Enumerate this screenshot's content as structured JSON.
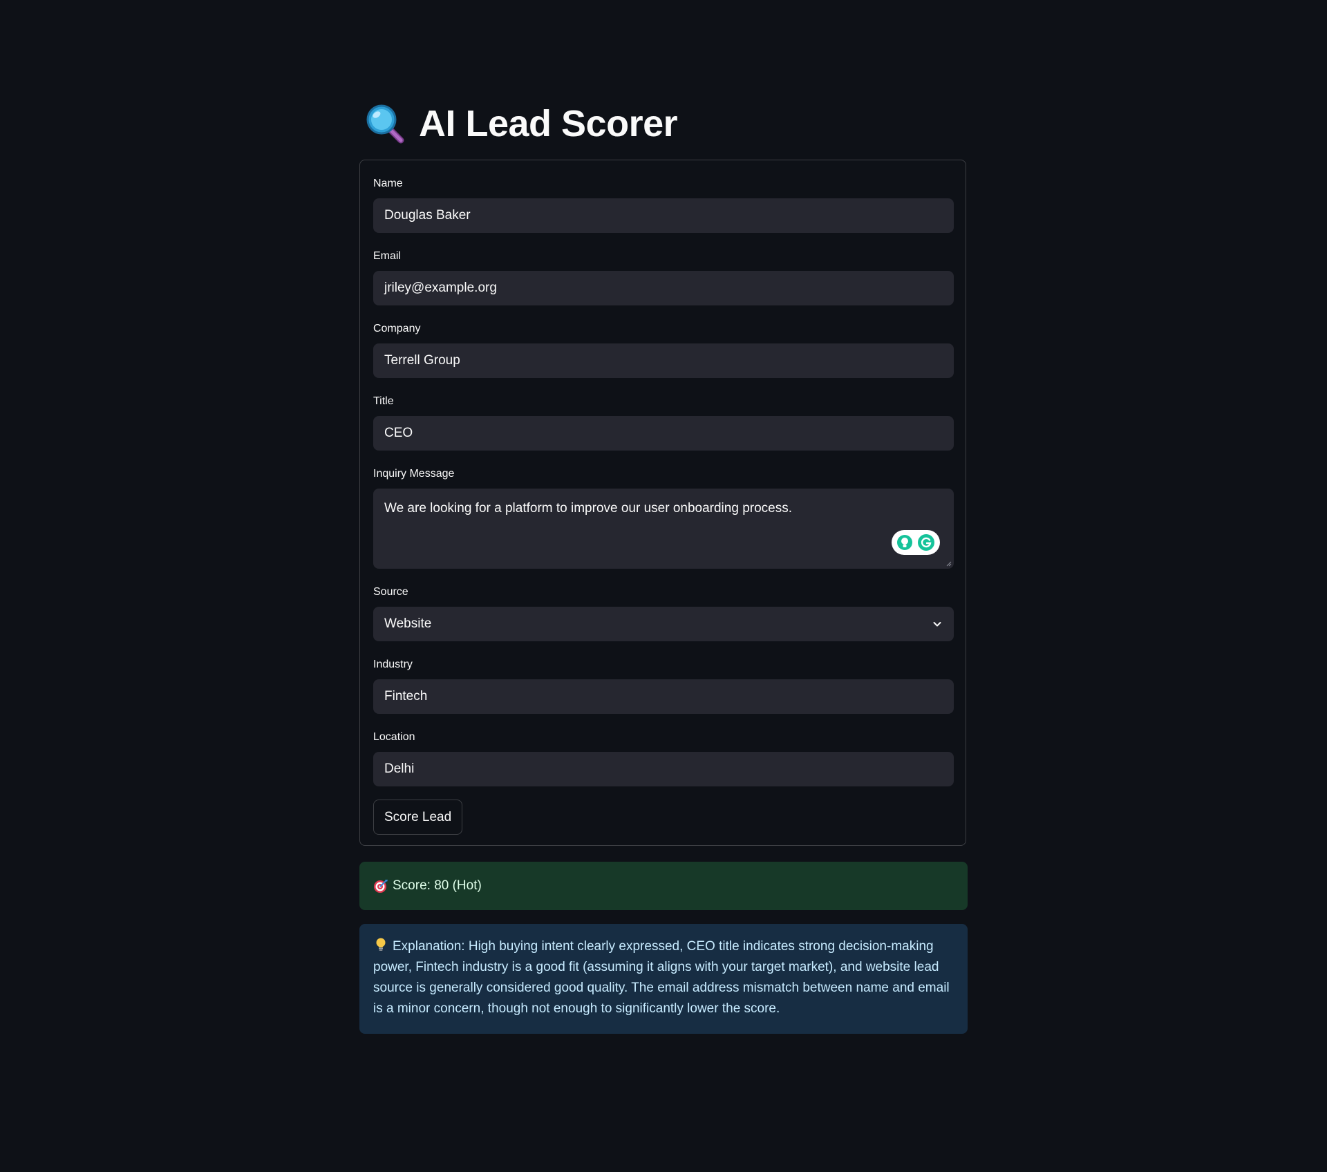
{
  "app": {
    "title": "AI Lead Scorer",
    "title_icon": "magnifying-glass-icon"
  },
  "form": {
    "fields": {
      "name": {
        "label": "Name",
        "value": "Douglas Baker"
      },
      "email": {
        "label": "Email",
        "value": "jriley@example.org"
      },
      "company": {
        "label": "Company",
        "value": "Terrell Group"
      },
      "title": {
        "label": "Title",
        "value": "CEO"
      },
      "inquiry": {
        "label": "Inquiry Message",
        "value": "We are looking for a platform to improve our user onboarding process."
      },
      "source": {
        "label": "Source",
        "value": "Website"
      },
      "industry": {
        "label": "Industry",
        "value": "Fintech"
      },
      "location": {
        "label": "Location",
        "value": "Delhi"
      }
    },
    "submit_label": "Score Lead"
  },
  "result": {
    "score_text": "Score: 80 (Hot)",
    "score_icon": "target-icon",
    "explanation_text": "Explanation: High buying intent clearly expressed, CEO title indicates strong decision-making power, Fintech industry is a good fit (assuming it aligns with your target market), and website lead source is generally considered good quality. The email address mismatch between name and email is a minor concern, though not enough to significantly lower the score.",
    "explanation_icon": "lightbulb-icon"
  },
  "colors": {
    "background": "#0e1117",
    "input_bg": "#262730",
    "success_bg": "#173928",
    "success_text": "#dffde9",
    "info_bg": "#172d43",
    "info_text": "#c7ebff",
    "grammarly_green": "#15c39a"
  }
}
